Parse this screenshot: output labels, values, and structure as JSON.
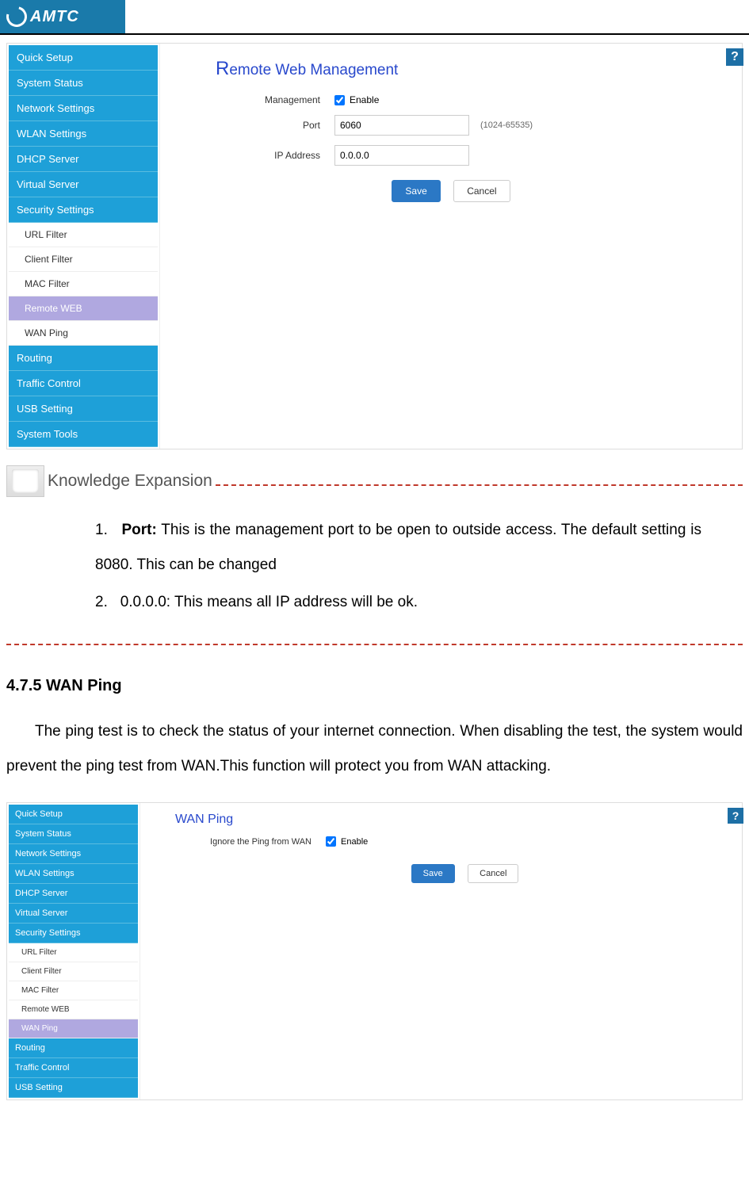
{
  "logo": {
    "text": "AMTC"
  },
  "screenshot1": {
    "sidebar": {
      "items": [
        "Quick Setup",
        "System Status",
        "Network Settings",
        "WLAN Settings",
        "DHCP Server",
        "Virtual Server",
        "Security Settings"
      ],
      "subs": [
        "URL Filter",
        "Client Filter",
        "MAC Filter",
        "Remote WEB",
        "WAN Ping"
      ],
      "active_sub_index": 3,
      "items2": [
        "Routing",
        "Traffic Control",
        "USB Setting",
        "System Tools"
      ]
    },
    "panel": {
      "title_r": "R",
      "title_rest": "emote Web Management",
      "management_label": "Management",
      "enable_label": "Enable",
      "port_label": "Port",
      "port_value": "6060",
      "port_hint": "(1024-65535)",
      "ip_label": "IP Address",
      "ip_value": "0.0.0.0",
      "save": "Save",
      "cancel": "Cancel"
    },
    "help": "?"
  },
  "knowledge": {
    "title": "Knowledge Expansion",
    "items": [
      {
        "num": "1.",
        "bold": "Port:",
        "rest": " This is the management port to be open to outside access. The default setting is 8080. This can be changed"
      },
      {
        "num": "2.",
        "bold": "",
        "rest": "0.0.0.0: This means all IP address will be ok."
      }
    ]
  },
  "section": {
    "title": "4.7.5 WAN Ping",
    "body": "The ping test is to check the status of your internet connection. When disabling the test, the system would prevent the ping test from WAN.This function will protect you from WAN attacking."
  },
  "screenshot2": {
    "sidebar": {
      "items": [
        "Quick Setup",
        "System Status",
        "Network Settings",
        "WLAN Settings",
        "DHCP Server",
        "Virtual Server",
        "Security Settings"
      ],
      "subs": [
        "URL Filter",
        "Client Filter",
        "MAC Filter",
        "Remote WEB",
        "WAN Ping"
      ],
      "active_sub_index": 4,
      "items2": [
        "Routing",
        "Traffic Control",
        "USB Setting"
      ]
    },
    "panel": {
      "title": "WAN Ping",
      "ignore_label": "Ignore the Ping from WAN",
      "enable_label": "Enable",
      "save": "Save",
      "cancel": "Cancel"
    },
    "help": "?"
  }
}
